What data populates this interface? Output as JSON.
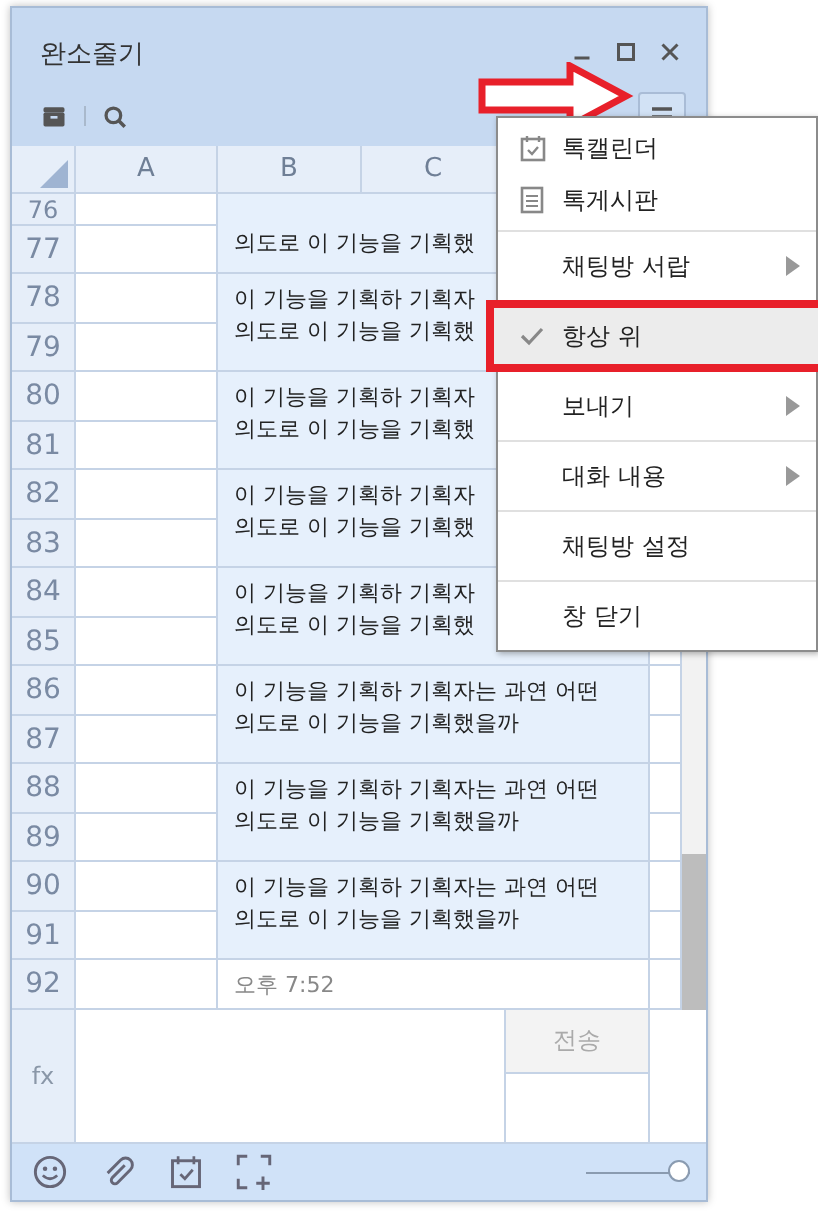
{
  "window": {
    "title": "완소줄기"
  },
  "columns": [
    "A",
    "B",
    "C"
  ],
  "blocks": [
    {
      "kind": "message",
      "numbers": [
        "76",
        "77"
      ],
      "text": "의도로 이 기능을 기획했"
    },
    {
      "kind": "message",
      "numbers": [
        "78",
        "79"
      ],
      "text": "이 기능을 기획하 기획자\n의도로 이 기능을 기획했"
    },
    {
      "kind": "message",
      "numbers": [
        "80",
        "81"
      ],
      "text": "이 기능을 기획하 기획자\n의도로 이 기능을 기획했"
    },
    {
      "kind": "message",
      "numbers": [
        "82",
        "83"
      ],
      "text": "이 기능을 기획하 기획자\n의도로 이 기능을 기획했"
    },
    {
      "kind": "message",
      "numbers": [
        "84",
        "85"
      ],
      "text": "이 기능을 기획하 기획자\n의도로 이 기능을 기획했"
    },
    {
      "kind": "message",
      "numbers": [
        "86",
        "87"
      ],
      "text": "이 기능을 기획하 기획자는 과연 어떤\n의도로 이 기능을 기획했을까"
    },
    {
      "kind": "message",
      "numbers": [
        "88",
        "89"
      ],
      "text": "이 기능을 기획하 기획자는 과연 어떤\n의도로 이 기능을 기획했을까"
    },
    {
      "kind": "message",
      "numbers": [
        "90",
        "91"
      ],
      "text": "이 기능을 기획하 기획자는 과연 어떤\n의도로 이 기능을 기획했을까"
    },
    {
      "kind": "time",
      "numbers": [
        "92"
      ],
      "text": "오후 7:52"
    }
  ],
  "input": {
    "formula_label": "fx",
    "send_button": "전송"
  },
  "zoom_slider": {
    "level": 1
  },
  "menu": {
    "groups": [
      [
        {
          "kind": "calendar",
          "label": "톡캘린더",
          "checked": false,
          "hovered": false,
          "annotated": false
        },
        {
          "kind": "board",
          "label": "톡게시판",
          "checked": false,
          "hovered": false,
          "annotated": false
        }
      ],
      [
        {
          "kind": "submenu",
          "label": "채팅방 서랍",
          "checked": false,
          "hovered": false,
          "annotated": false
        }
      ],
      [
        {
          "kind": "plain",
          "label": "항상 위",
          "checked": true,
          "hovered": true,
          "annotated": true
        }
      ],
      [
        {
          "kind": "submenu",
          "label": "보내기",
          "checked": false,
          "hovered": false,
          "annotated": false
        }
      ],
      [
        {
          "kind": "submenu",
          "label": "대화 내용",
          "checked": false,
          "hovered": false,
          "annotated": false
        }
      ],
      [
        {
          "kind": "plain",
          "label": "채팅방 설정",
          "checked": false,
          "hovered": false,
          "annotated": false
        }
      ],
      [
        {
          "kind": "plain",
          "label": "창 닫기",
          "checked": false,
          "hovered": false,
          "annotated": false
        }
      ]
    ]
  },
  "annotations": [
    {
      "kind": "arrow"
    }
  ]
}
